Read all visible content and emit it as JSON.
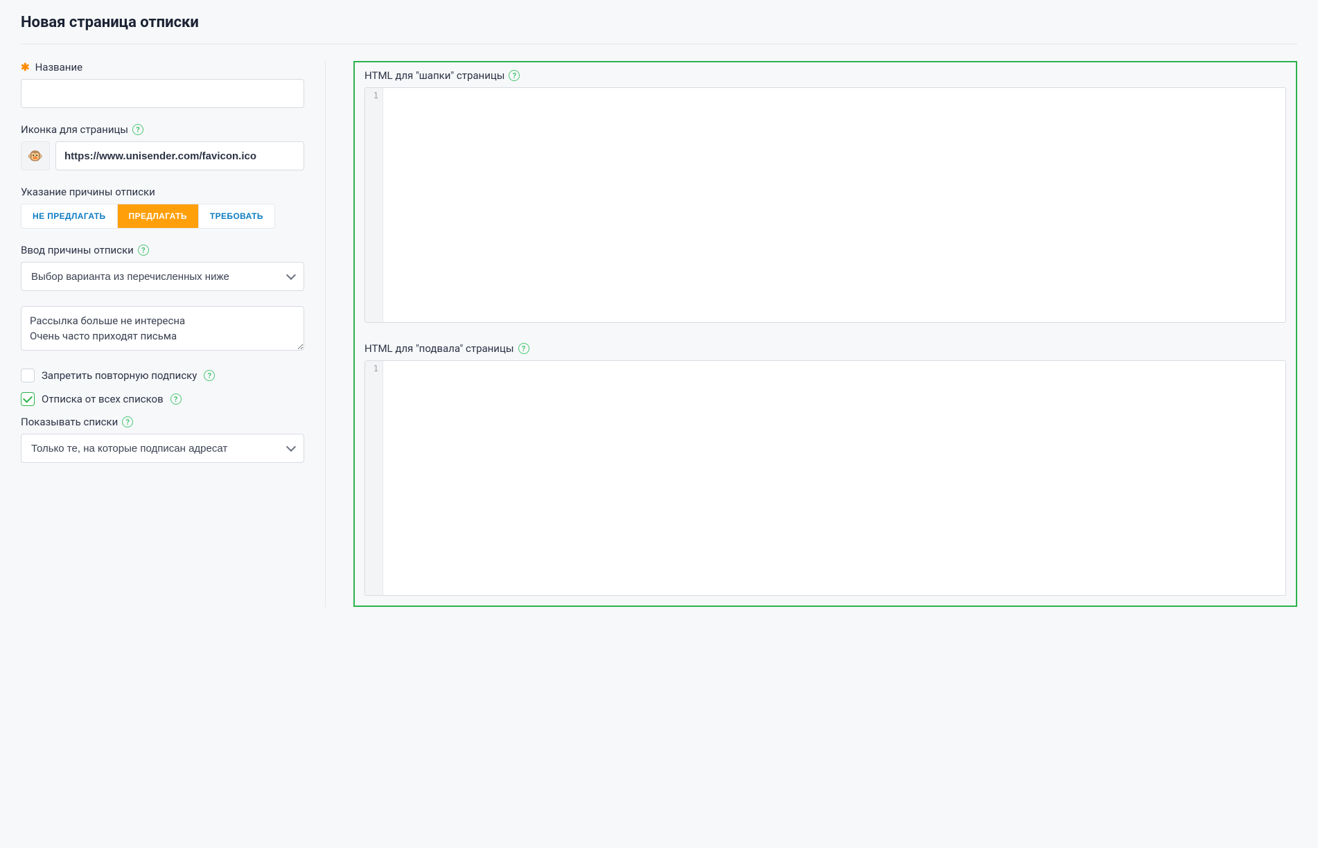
{
  "page": {
    "title": "Новая страница отписки"
  },
  "left": {
    "name_label": "Название",
    "name_value": "",
    "favicon_label": "Иконка для страницы",
    "favicon_url": "https://www.unisender.com/favicon.ico",
    "reason_mode_label": "Указание причины отписки",
    "reason_mode_options": {
      "none": "НЕ ПРЕДЛАГАТЬ",
      "offer": "ПРЕДЛАГАТЬ",
      "require": "ТРЕБОВАТЬ"
    },
    "reason_input_label": "Ввод причины отписки",
    "reason_input_selected": "Выбор варианта из перечисленных ниже",
    "reasons_text": "Рассылка больше не интересна\nОчень часто приходят письма",
    "forbid_resubscribe_label": "Запретить повторную подписку",
    "unsubscribe_all_label": "Отписка от всех списков",
    "show_lists_label": "Показывать списки",
    "show_lists_selected": "Только те, на которые подписан адресат"
  },
  "right": {
    "header_html_label": "HTML для \"шапки\" страницы",
    "footer_html_label": "HTML для \"подвала\" страницы",
    "line_number": "1"
  }
}
